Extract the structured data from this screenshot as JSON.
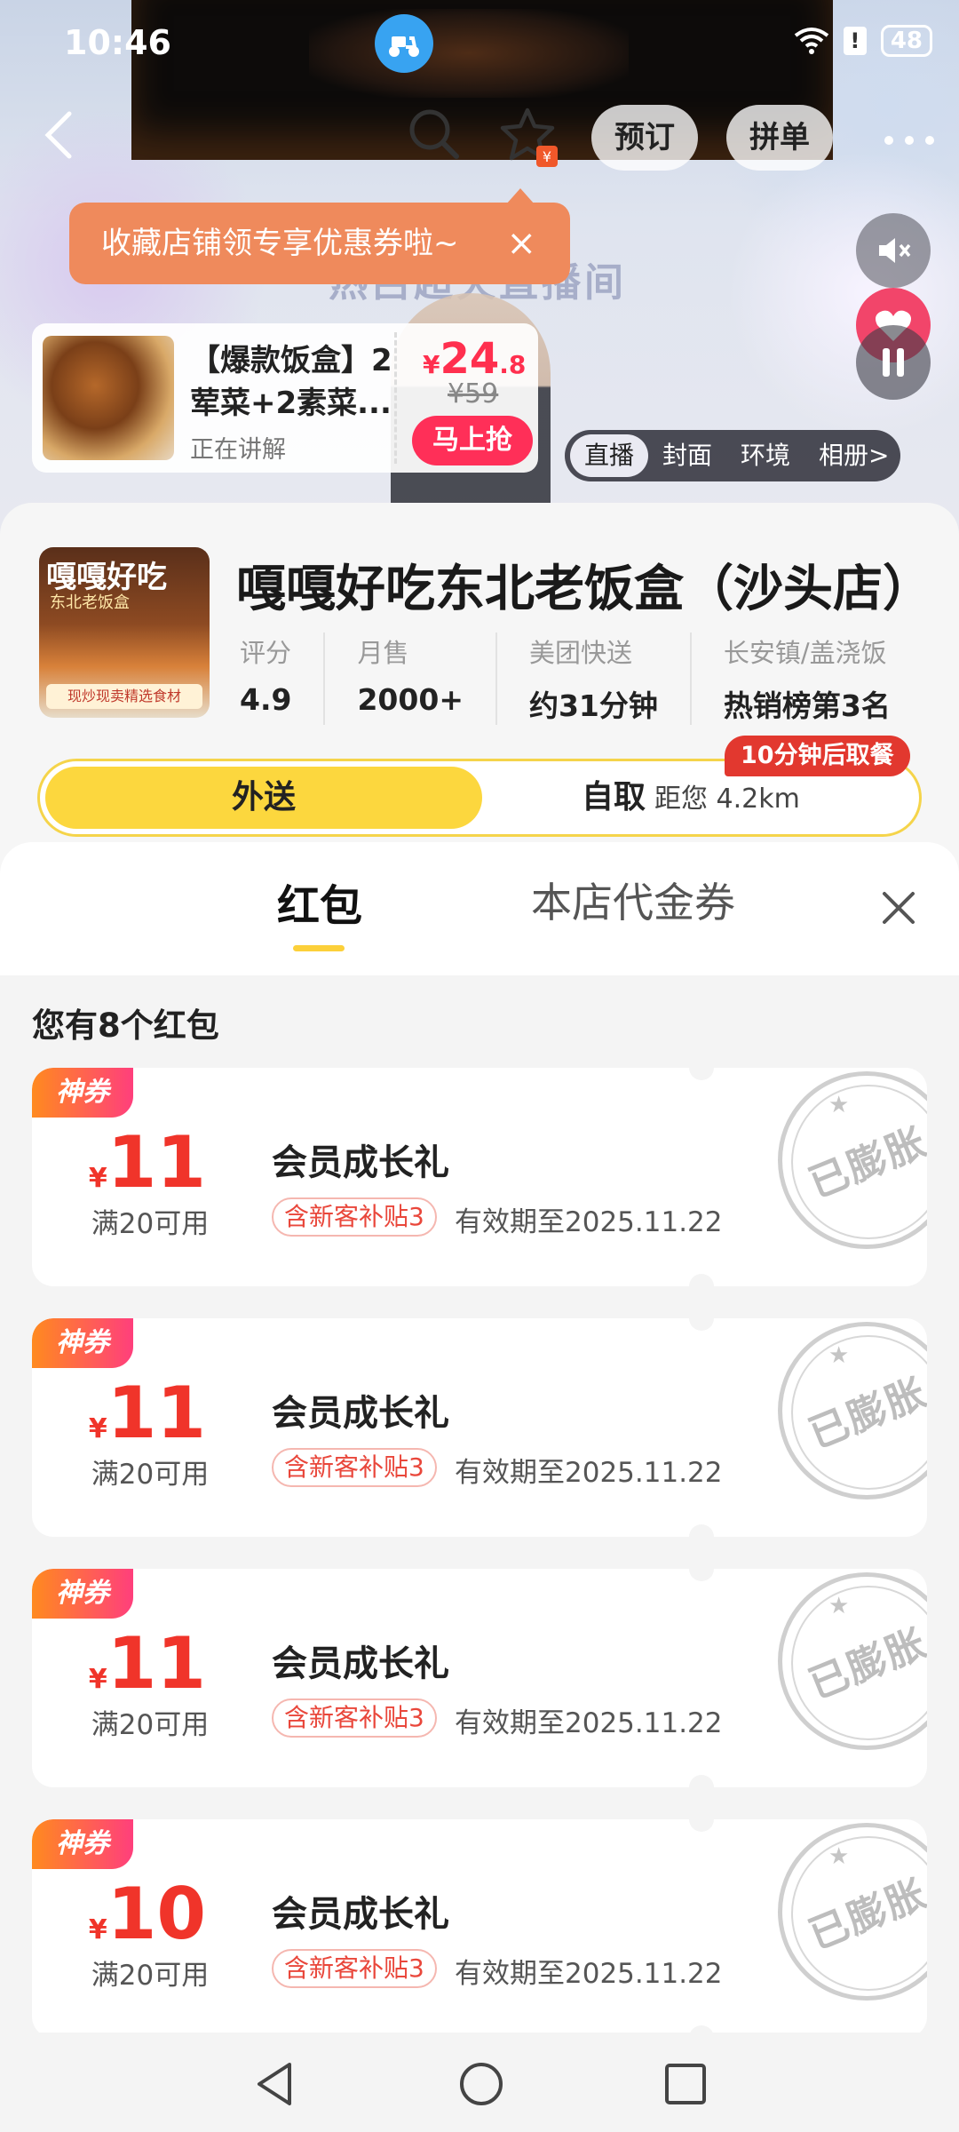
{
  "status_bar": {
    "time": "10:46",
    "battery": "48"
  },
  "nav": {
    "reserve_label": "预订",
    "group_label": "拼单"
  },
  "live": {
    "background_title": "热吕超火直播间"
  },
  "tooltip": {
    "text": "收藏店铺领专享优惠券啦~",
    "close": "×"
  },
  "product": {
    "name": "【爆款饭盒】2荤菜+2素菜...",
    "status": "正在讲解",
    "price_currency": "¥",
    "price_int": "24",
    "price_dec": ".8",
    "original_price": "¥59",
    "buy_button": "马上抢"
  },
  "mode_tabs": [
    "直播",
    "封面",
    "环境",
    "相册>"
  ],
  "store": {
    "logo_title": "嘎嘎好吃",
    "logo_sub": "东北老饭盒",
    "logo_slogan": "现炒现卖精选食材",
    "name": "嘎嘎好吃东北老饭盒（沙头店）",
    "stats": [
      {
        "label": "评分",
        "value": "4.9"
      },
      {
        "label": "月售",
        "value": "2000+"
      },
      {
        "label": "美团快送",
        "value": "约31分钟"
      },
      {
        "label": "长安镇/盖浇饭",
        "value": "热销榜第3名"
      }
    ],
    "delivery_label": "外送",
    "pickup_label": "自取",
    "pickup_distance": "距您 4.2km",
    "pickup_badge": "10分钟后取餐"
  },
  "sheet": {
    "tab_redpacket": "红包",
    "tab_voucher": "本店代金券",
    "count_title": "您有8个红包",
    "coupons": [
      {
        "tag": "神券",
        "currency": "¥",
        "amount": "11",
        "threshold": "满20可用",
        "name": "会员成长礼",
        "subsidy": "含新客补贴3",
        "validity": "有效期至2025.11.22",
        "stamp": "已膨胀"
      },
      {
        "tag": "神券",
        "currency": "¥",
        "amount": "11",
        "threshold": "满20可用",
        "name": "会员成长礼",
        "subsidy": "含新客补贴3",
        "validity": "有效期至2025.11.22",
        "stamp": "已膨胀"
      },
      {
        "tag": "神券",
        "currency": "¥",
        "amount": "11",
        "threshold": "满20可用",
        "name": "会员成长礼",
        "subsidy": "含新客补贴3",
        "validity": "有效期至2025.11.22",
        "stamp": "已膨胀"
      },
      {
        "tag": "神券",
        "currency": "¥",
        "amount": "10",
        "threshold": "满20可用",
        "name": "会员成长礼",
        "subsidy": "含新客补贴3",
        "validity": "有效期至2025.11.22",
        "stamp": "已膨胀"
      }
    ]
  },
  "colors": {
    "accent_yellow": "#fcd73e",
    "price_red": "#f0342a",
    "tooltip_orange": "#ef8a5c"
  }
}
